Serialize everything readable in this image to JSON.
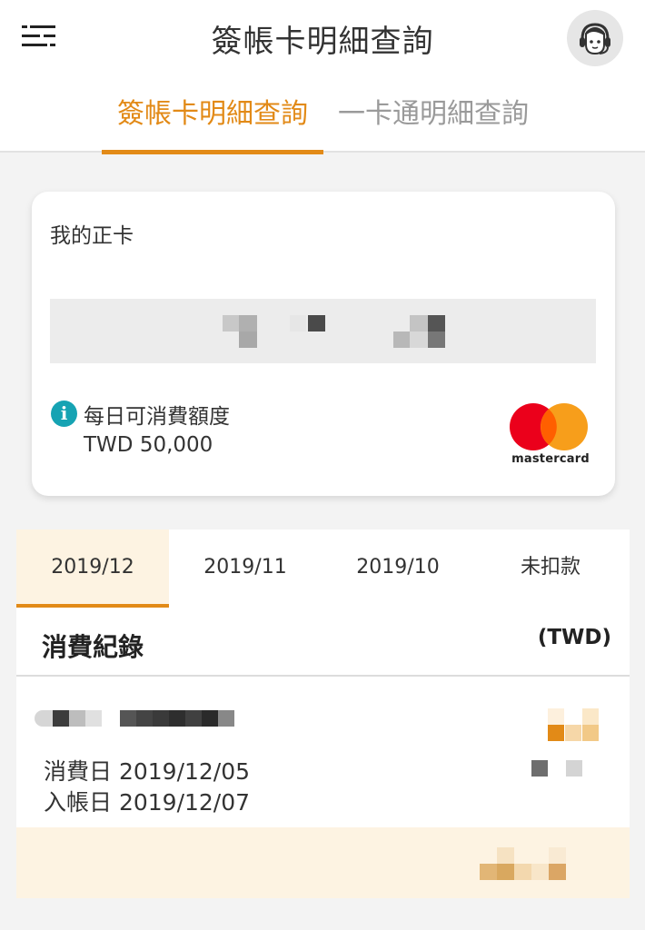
{
  "header": {
    "title": "簽帳卡明細查詢",
    "menu_icon": "menu-icon",
    "support_icon": "customer-service-icon"
  },
  "tabs": [
    {
      "label": "簽帳卡明細查詢",
      "active": true
    },
    {
      "label": "一卡通明細查詢",
      "active": false
    }
  ],
  "card": {
    "name": "我的正卡",
    "limit_label": "每日可消費額度",
    "limit_value": "TWD 50,000",
    "brand": "mastercard"
  },
  "months": [
    {
      "label": "2019/12",
      "active": true
    },
    {
      "label": "2019/11",
      "active": false
    },
    {
      "label": "2019/10",
      "active": false
    },
    {
      "label": "未扣款",
      "active": false
    }
  ],
  "records": {
    "title": "消費紀錄",
    "currency": "(TWD)",
    "items": [
      {
        "purchase_date": "消費日 2019/12/05",
        "posting_date": "入帳日 2019/12/07"
      }
    ]
  },
  "colors": {
    "accent": "#e28a17",
    "info": "#16a3b3",
    "mastercard_red": "#eb001b",
    "mastercard_yellow": "#f79e1b",
    "mastercard_overlap": "#ff5f00"
  }
}
